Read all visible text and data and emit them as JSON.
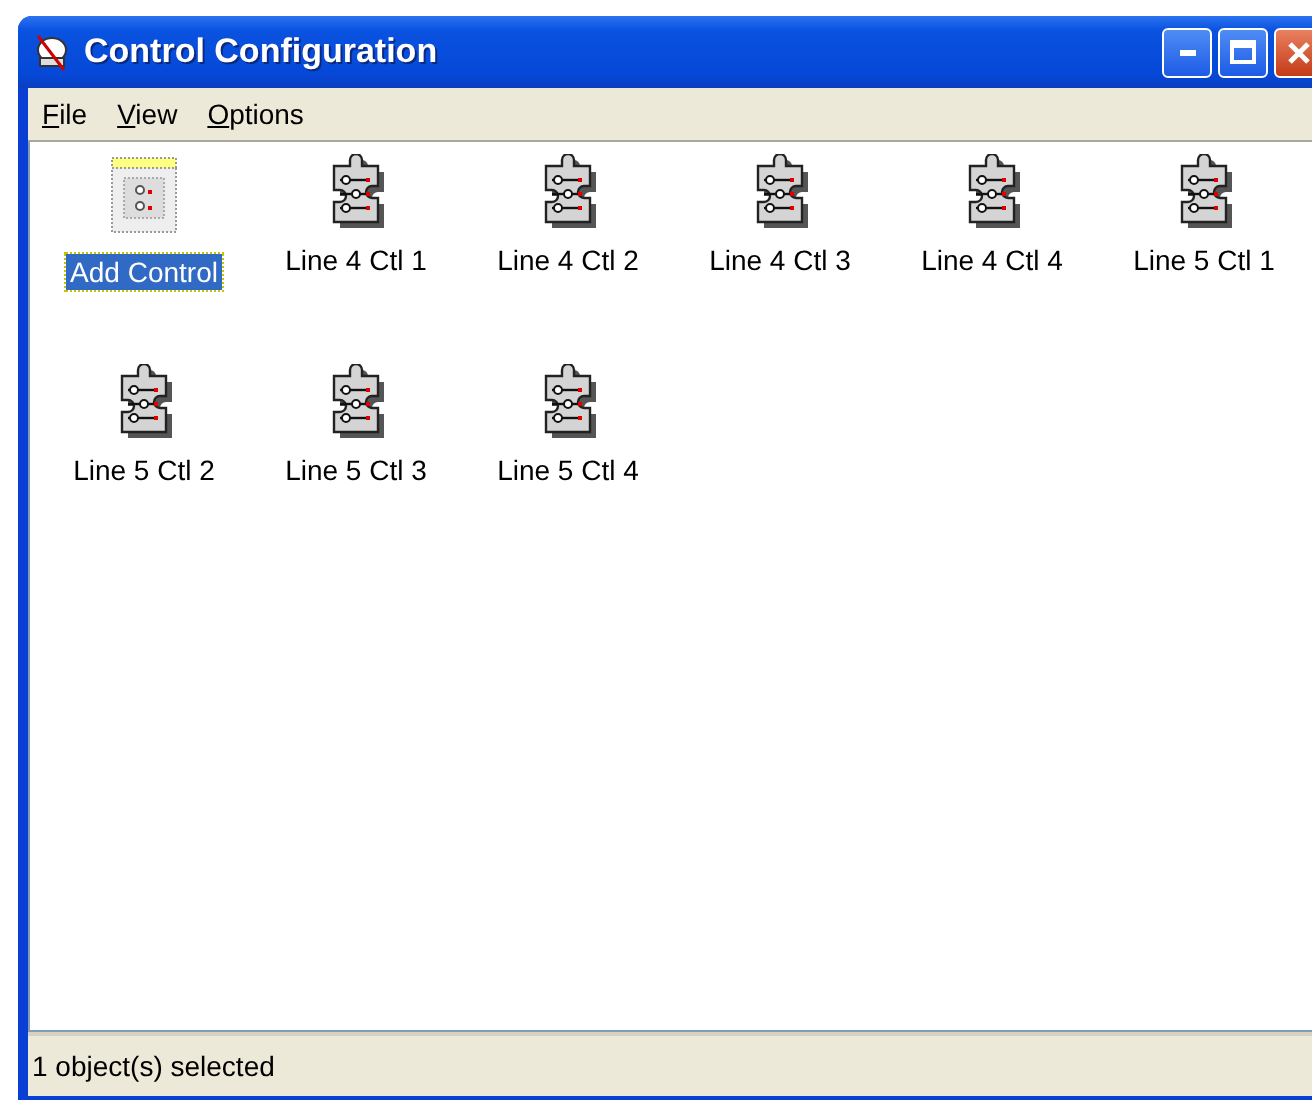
{
  "window": {
    "title": "Control Configuration"
  },
  "menu": [
    {
      "label": "File"
    },
    {
      "label": "View"
    },
    {
      "label": "Options"
    }
  ],
  "items": [
    {
      "label": "Add Control",
      "kind": "add",
      "selected": true
    },
    {
      "label": "Line 4 Ctl 1",
      "kind": "control",
      "selected": false
    },
    {
      "label": "Line 4 Ctl 2",
      "kind": "control",
      "selected": false
    },
    {
      "label": "Line 4 Ctl 3",
      "kind": "control",
      "selected": false
    },
    {
      "label": "Line 4 Ctl 4",
      "kind": "control",
      "selected": false
    },
    {
      "label": "Line 5 Ctl 1",
      "kind": "control",
      "selected": false
    },
    {
      "label": "Line 5 Ctl 2",
      "kind": "control",
      "selected": false
    },
    {
      "label": "Line 5 Ctl 3",
      "kind": "control",
      "selected": false
    },
    {
      "label": "Line 5 Ctl 4",
      "kind": "control",
      "selected": false
    }
  ],
  "status_bar": "1 object(s) selected"
}
